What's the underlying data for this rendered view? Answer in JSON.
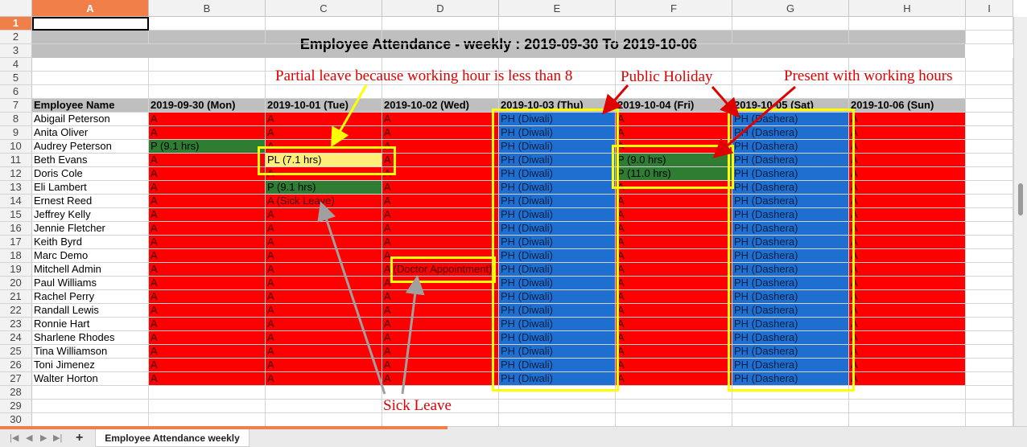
{
  "columns": [
    "A",
    "B",
    "C",
    "D",
    "E",
    "F",
    "G",
    "H",
    "I"
  ],
  "rows": [
    "1",
    "2",
    "3",
    "4",
    "5",
    "6",
    "7",
    "8",
    "9",
    "10",
    "11",
    "12",
    "13",
    "14",
    "15",
    "16",
    "17",
    "18",
    "19",
    "20",
    "21",
    "22",
    "23",
    "24",
    "25",
    "26",
    "27",
    "28",
    "29",
    "30"
  ],
  "active_column": "A",
  "active_row": "1",
  "title": "Employee Attendance - weekly : 2019-09-30 To 2019-10-06",
  "headers": [
    "Employee Name",
    "2019-09-30 (Mon)",
    "2019-10-01 (Tue)",
    "2019-10-02 (Wed)",
    "2019-10-03 (Thu)",
    "2019-10-04 (Fri)",
    "2019-10-05 (Sat)",
    "2019-10-06 (Sun)"
  ],
  "employees": [
    {
      "name": "Abigail Peterson",
      "days": [
        "A",
        "A",
        "A",
        "PH (Diwali)",
        "A",
        "PH (Dashera)",
        "A"
      ]
    },
    {
      "name": "Anita Oliver",
      "days": [
        "A",
        "A",
        "A",
        "PH (Diwali)",
        "A",
        "PH (Dashera)",
        "A"
      ]
    },
    {
      "name": "Audrey Peterson",
      "days": [
        "P (9.1 hrs)",
        "A",
        "A",
        "PH (Diwali)",
        "A",
        "PH (Dashera)",
        "A"
      ]
    },
    {
      "name": "Beth Evans",
      "days": [
        "A",
        "PL (7.1 hrs)",
        "A",
        "PH (Diwali)",
        "P (9.0 hrs)",
        "PH (Dashera)",
        "A"
      ]
    },
    {
      "name": "Doris Cole",
      "days": [
        "A",
        "A",
        "A",
        "PH (Diwali)",
        "P (11.0 hrs)",
        "PH (Dashera)",
        "A"
      ]
    },
    {
      "name": "Eli Lambert",
      "days": [
        "A",
        "P (9.1 hrs)",
        "A",
        "PH (Diwali)",
        "A",
        "PH (Dashera)",
        "A"
      ]
    },
    {
      "name": "Ernest Reed",
      "days": [
        "A",
        "A (Sick Leave)",
        "A",
        "PH (Diwali)",
        "A",
        "PH (Dashera)",
        "A"
      ]
    },
    {
      "name": "Jeffrey Kelly",
      "days": [
        "A",
        "A",
        "A",
        "PH (Diwali)",
        "A",
        "PH (Dashera)",
        "A"
      ]
    },
    {
      "name": "Jennie Fletcher",
      "days": [
        "A",
        "A",
        "A",
        "PH (Diwali)",
        "A",
        "PH (Dashera)",
        "A"
      ]
    },
    {
      "name": "Keith Byrd",
      "days": [
        "A",
        "A",
        "A",
        "PH (Diwali)",
        "A",
        "PH (Dashera)",
        "A"
      ]
    },
    {
      "name": "Marc Demo",
      "days": [
        "A",
        "A",
        "A",
        "PH (Diwali)",
        "A",
        "PH (Dashera)",
        "A"
      ]
    },
    {
      "name": "Mitchell Admin",
      "days": [
        "A",
        "A",
        "A (Doctor Appointment)",
        "PH (Diwali)",
        "A",
        "PH (Dashera)",
        "A"
      ]
    },
    {
      "name": "Paul Williams",
      "days": [
        "A",
        "A",
        "A",
        "PH (Diwali)",
        "A",
        "PH (Dashera)",
        "A"
      ]
    },
    {
      "name": "Rachel Perry",
      "days": [
        "A",
        "A",
        "A",
        "PH (Diwali)",
        "A",
        "PH (Dashera)",
        "A"
      ]
    },
    {
      "name": "Randall Lewis",
      "days": [
        "A",
        "A",
        "A",
        "PH (Diwali)",
        "A",
        "PH (Dashera)",
        "A"
      ]
    },
    {
      "name": "Ronnie Hart",
      "days": [
        "A",
        "A",
        "A",
        "PH (Diwali)",
        "A",
        "PH (Dashera)",
        "A"
      ]
    },
    {
      "name": "Sharlene Rhodes",
      "days": [
        "A",
        "A",
        "A",
        "PH (Diwali)",
        "A",
        "PH (Dashera)",
        "A"
      ]
    },
    {
      "name": "Tina Williamson",
      "days": [
        "A",
        "A",
        "A",
        "PH (Diwali)",
        "A",
        "PH (Dashera)",
        "A"
      ]
    },
    {
      "name": "Toni Jimenez",
      "days": [
        "A",
        "A",
        "A",
        "PH (Diwali)",
        "A",
        "PH (Dashera)",
        "A"
      ]
    },
    {
      "name": "Walter Horton",
      "days": [
        "A",
        "A",
        "A",
        "PH (Diwali)",
        "A",
        "PH (Dashera)",
        "A"
      ]
    }
  ],
  "annotations": {
    "partial_leave": "Partial leave because working hour is less than 8",
    "public_holiday": "Public Holiday",
    "present_hours": "Present with working hours",
    "sick_leave": "Sick Leave"
  },
  "sheet_tab": "Employee Attendance weekly",
  "add_sheet_icon": "+",
  "nav_icons": [
    "first-sheet-icon",
    "prev-sheet-icon",
    "next-sheet-icon",
    "last-sheet-icon"
  ],
  "colors": {
    "absent": "#ff0000",
    "present": "#2e7d32",
    "holiday": "#1f6fd0",
    "partial": "#ffee77",
    "header": "#bfbfbf",
    "annotation": "#e00000",
    "highlight_box": "#ffff00",
    "active_header": "#f07f4a"
  }
}
